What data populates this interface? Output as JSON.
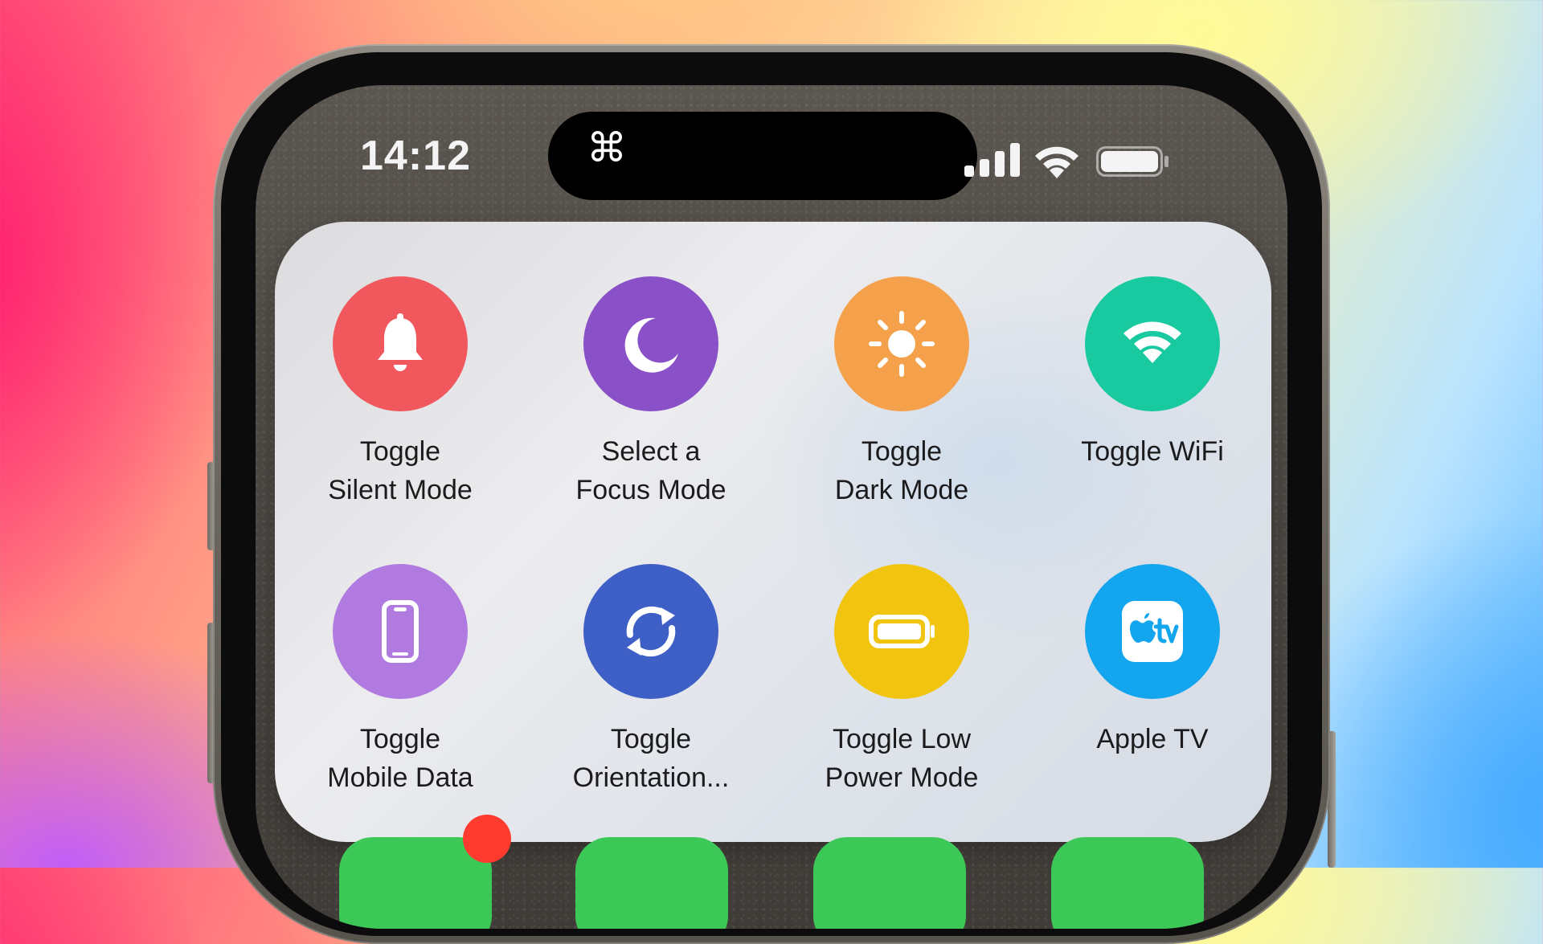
{
  "status_bar": {
    "time": "14:12",
    "island_icon": "command-icon",
    "island_glyph": "⌘",
    "signal_icon": "cellular-signal-icon",
    "wifi_icon": "wifi-icon",
    "battery_icon": "battery-icon"
  },
  "widget": {
    "shortcuts": [
      {
        "label": "Toggle\nSilent Mode",
        "icon": "bell-icon",
        "color": "#f0585e"
      },
      {
        "label": "Select a\nFocus Mode",
        "icon": "moon-icon",
        "color": "#8a50c8"
      },
      {
        "label": "Toggle\nDark Mode",
        "icon": "sun-icon",
        "color": "#f5a04a"
      },
      {
        "label": "Toggle WiFi",
        "icon": "wifi-icon",
        "color": "#19c9a0"
      },
      {
        "label": "Toggle\nMobile Data",
        "icon": "phone-icon",
        "color": "#b07ae0"
      },
      {
        "label": "Toggle\nOrientation...",
        "icon": "rotate-icon",
        "color": "#3e5fc6"
      },
      {
        "label": "Toggle Low\nPower Mode",
        "icon": "battery-icon",
        "color": "#f1c40f"
      },
      {
        "label": "Apple TV",
        "icon": "apple-tv-icon",
        "color": "#13a6ee"
      }
    ]
  }
}
